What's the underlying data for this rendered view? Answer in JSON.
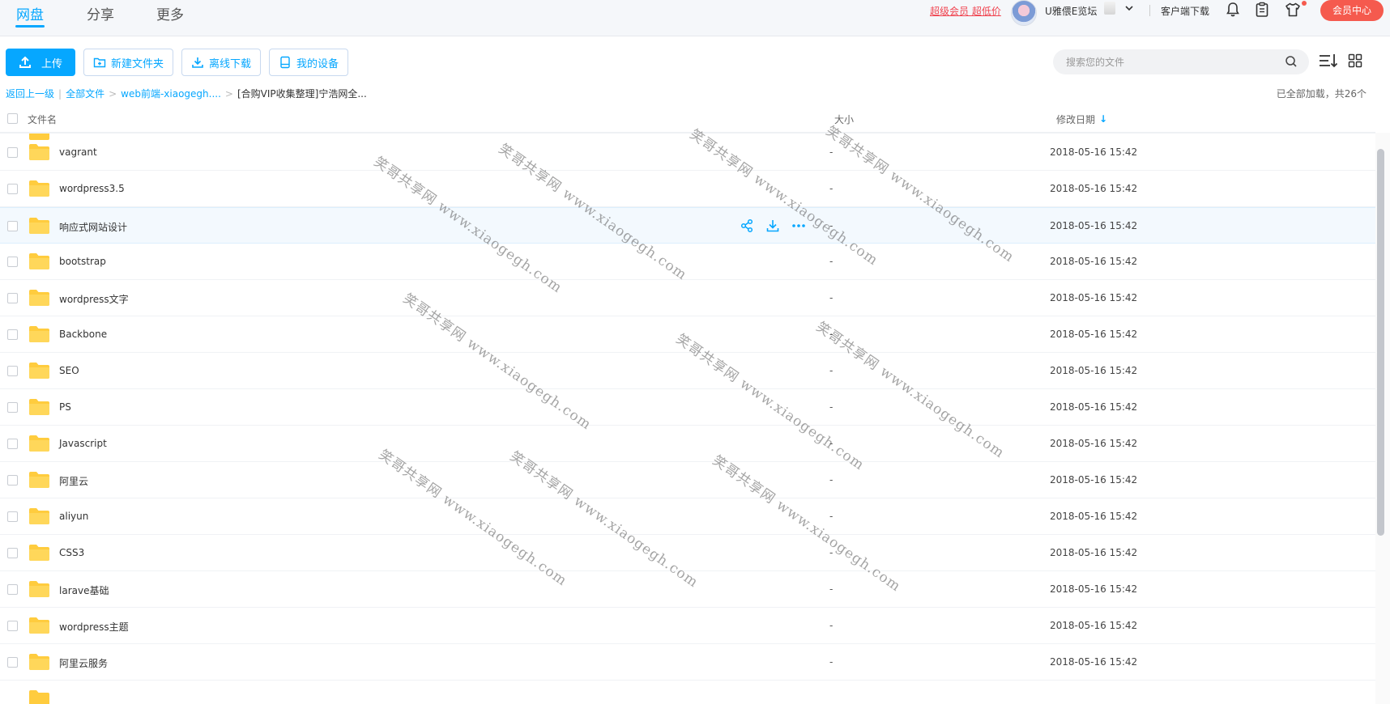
{
  "nav": {
    "tabs": [
      {
        "label": "网盘",
        "active": true
      },
      {
        "label": "分享",
        "active": false
      },
      {
        "label": "更多",
        "active": false
      }
    ],
    "vip_promo": "超级会员 超低价",
    "username": "U雅偎E览坛",
    "client_download": "客户端下载",
    "vip_center": "会员中心",
    "icons": [
      "bell-icon",
      "clipboard-icon",
      "tshirt-icon"
    ]
  },
  "toolbar": {
    "upload": "上传",
    "new_folder": "新建文件夹",
    "offline_download": "离线下载",
    "my_devices": "我的设备",
    "search_placeholder": "搜索您的文件"
  },
  "breadcrumb": {
    "back": "返回上一级",
    "all_files": "全部文件",
    "level1": "web前端-xiaogegh....",
    "current": "[合购VIP收集整理]宁浩网全...",
    "loaded_status": "已全部加载，共26个"
  },
  "table": {
    "col_name": "文件名",
    "col_size": "大小",
    "col_date": "修改日期",
    "rows": [
      {
        "name": "vagrant",
        "size": "-",
        "date": "2018-05-16 15:42"
      },
      {
        "name": "wordpress3.5",
        "size": "-",
        "date": "2018-05-16 15:42"
      },
      {
        "name": "响应式网站设计",
        "size": "-",
        "date": "2018-05-16 15:42"
      },
      {
        "name": "bootstrap",
        "size": "-",
        "date": "2018-05-16 15:42"
      },
      {
        "name": "wordpress文字",
        "size": "-",
        "date": "2018-05-16 15:42"
      },
      {
        "name": "Backbone",
        "size": "-",
        "date": "2018-05-16 15:42"
      },
      {
        "name": "SEO",
        "size": "-",
        "date": "2018-05-16 15:42"
      },
      {
        "name": "PS",
        "size": "-",
        "date": "2018-05-16 15:42"
      },
      {
        "name": "Javascript",
        "size": "-",
        "date": "2018-05-16 15:42"
      },
      {
        "name": "阿里云",
        "size": "-",
        "date": "2018-05-16 15:42"
      },
      {
        "name": "aliyun",
        "size": "-",
        "date": "2018-05-16 15:42"
      },
      {
        "name": "CSS3",
        "size": "-",
        "date": "2018-05-16 15:42"
      },
      {
        "name": "larave基础",
        "size": "-",
        "date": "2018-05-16 15:42"
      },
      {
        "name": "wordpress主题",
        "size": "-",
        "date": "2018-05-16 15:42"
      },
      {
        "name": "阿里云服务",
        "size": "-",
        "date": "2018-05-16 15:42"
      }
    ]
  },
  "watermark": "笑哥共享网 www.xiaogegh.com",
  "colors": {
    "accent": "#06a7ff",
    "vip_red": "#f55a4e",
    "folder": "#ffcc3e"
  }
}
